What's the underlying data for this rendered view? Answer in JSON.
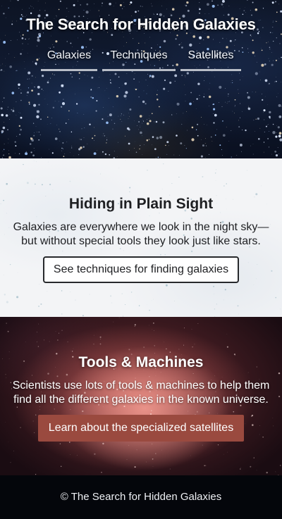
{
  "header": {
    "title": "The Search for Hidden Galaxies",
    "nav": [
      {
        "label": "Galaxies"
      },
      {
        "label": "Techniques"
      },
      {
        "label": "Satellites"
      }
    ]
  },
  "plain_sight": {
    "heading": "Hiding in Plain Sight",
    "text": "Galaxies are everywhere we look in the night sky—but without special tools they look just like stars.",
    "button": "See techniques for finding galaxies"
  },
  "tools": {
    "heading": "Tools & Machines",
    "text": "Scientists use lots of tools & machines to help them find all the different galaxies in the known universe.",
    "button": "Learn about the specialized satellites",
    "button_color": "#9a4a3f"
  },
  "footer": {
    "text": "© The Search for Hidden Galaxies"
  }
}
